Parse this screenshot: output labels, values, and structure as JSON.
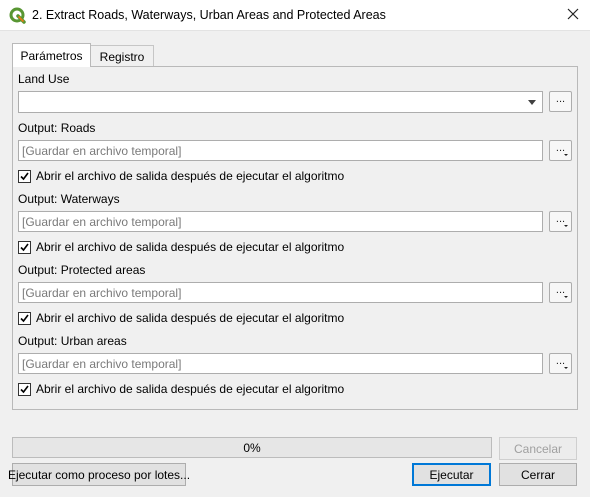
{
  "window": {
    "title": "2. Extract Roads, Waterways, Urban Areas and Protected Areas",
    "icon": "qgis-logo-icon",
    "close_icon": "close-icon"
  },
  "tabs": [
    {
      "label": "Parámetros",
      "active": true
    },
    {
      "label": "Registro",
      "active": false
    }
  ],
  "params": {
    "land_use": {
      "label": "Land Use",
      "value": "",
      "browse_label": "..."
    },
    "outputs": [
      {
        "label": "Output: Roads",
        "placeholder": "[Guardar en archivo temporal]",
        "browse_label": "...",
        "open_after": {
          "checked": true,
          "label": "Abrir el archivo de salida después de ejecutar el algoritmo"
        }
      },
      {
        "label": "Output: Waterways",
        "placeholder": "[Guardar en archivo temporal]",
        "browse_label": "...",
        "open_after": {
          "checked": true,
          "label": "Abrir el archivo de salida después de ejecutar el algoritmo"
        }
      },
      {
        "label": "Output: Protected areas",
        "placeholder": "[Guardar en archivo temporal]",
        "browse_label": "...",
        "open_after": {
          "checked": true,
          "label": "Abrir el archivo de salida después de ejecutar el algoritmo"
        }
      },
      {
        "label": "Output: Urban areas",
        "placeholder": "[Guardar en archivo temporal]",
        "browse_label": "...",
        "open_after": {
          "checked": true,
          "label": "Abrir el archivo de salida después de ejecutar el algoritmo"
        }
      }
    ]
  },
  "progress": {
    "text": "0%",
    "value": 0
  },
  "buttons": {
    "cancel": "Cancelar",
    "batch": "Ejecutar como proceso por lotes...",
    "run": "Ejecutar",
    "close": "Cerrar"
  }
}
